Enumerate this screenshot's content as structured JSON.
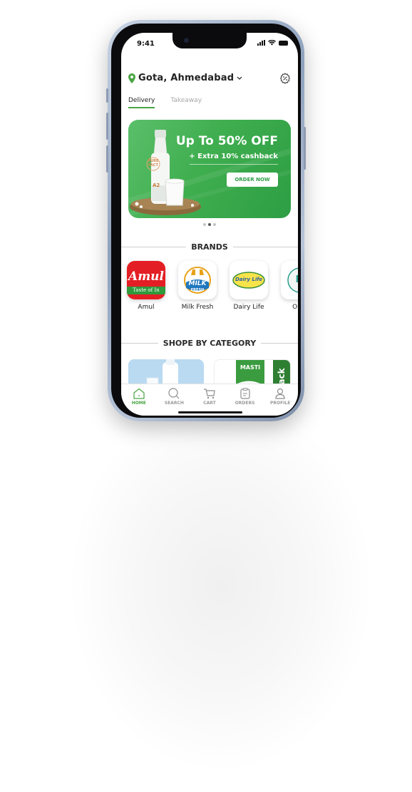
{
  "status_bar": {
    "time": "9:41"
  },
  "location": {
    "label": "Gota, Ahmedabad",
    "pin_color": "#4aa543"
  },
  "tabs": [
    {
      "label": "Delivery",
      "active": true
    },
    {
      "label": "Takeaway",
      "active": false
    }
  ],
  "banner": {
    "headline": "Up To 50% OFF",
    "subline": "+ Extra 10% cashback",
    "cta_label": "ORDER NOW",
    "bottle_label_top": "PURE FACT",
    "bottle_label_bottom": "A2",
    "bg_color": "#3fae4f"
  },
  "carousel": {
    "count": 3,
    "active_index": 1
  },
  "brands": {
    "title": "BRANDS",
    "items": [
      {
        "label": "Amul",
        "logo_text": "Amul",
        "logo_tagline": "Taste of In"
      },
      {
        "label": "Milk Fresh",
        "logo_text": "MILK",
        "logo_tagline": "FRESH"
      },
      {
        "label": "Dairy Life",
        "logo_text": "Dairy Life"
      },
      {
        "label": "Orga",
        "logo_text": "M"
      }
    ]
  },
  "categories": {
    "title": "SHOPE BY CATEGORY",
    "items": [
      {
        "name": "milk"
      },
      {
        "name": "masti",
        "tile_text": "MASTI",
        "side_text": "Pack"
      }
    ]
  },
  "bottom_nav": [
    {
      "label": "HOME",
      "icon": "home-icon",
      "active": true
    },
    {
      "label": "SEARCH",
      "icon": "search-icon",
      "active": false
    },
    {
      "label": "CART",
      "icon": "cart-icon",
      "active": false
    },
    {
      "label": "ORDERS",
      "icon": "orders-icon",
      "active": false
    },
    {
      "label": "PROFILE",
      "icon": "profile-icon",
      "active": false
    }
  ],
  "colors": {
    "accent": "#4aa543",
    "amul_red": "#e31e24",
    "text": "#222222"
  }
}
